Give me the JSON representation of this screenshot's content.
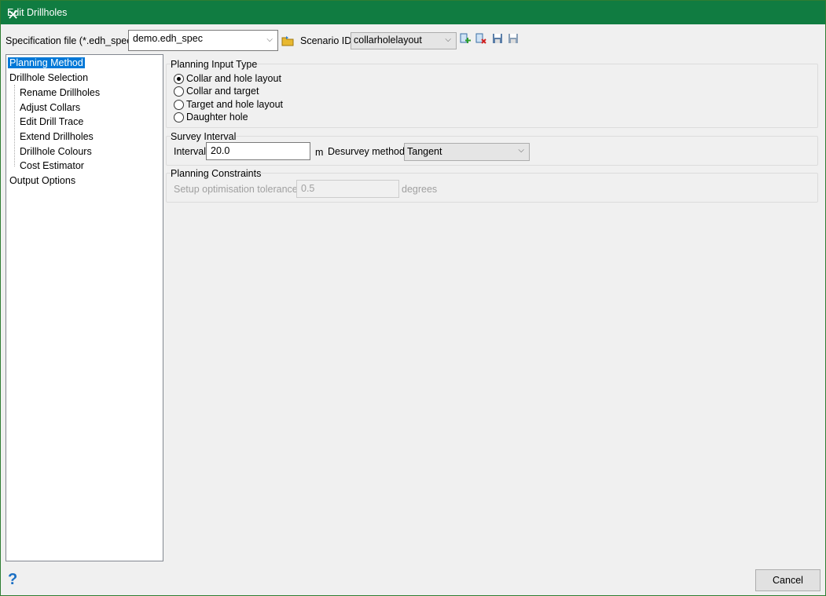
{
  "window": {
    "title": "Edit Drillholes"
  },
  "toolbar": {
    "spec_label": "Specification file (*.edh_spec)",
    "spec_value": "demo.edh_spec",
    "scenario_label": "Scenario ID",
    "scenario_value": "collarholelayout"
  },
  "tree": {
    "items": [
      {
        "label": "Planning Method"
      },
      {
        "label": "Drillhole Selection"
      },
      {
        "label": "Rename Drillholes"
      },
      {
        "label": "Adjust Collars"
      },
      {
        "label": "Edit Drill Trace"
      },
      {
        "label": "Extend Drillholes"
      },
      {
        "label": "Drillhole Colours"
      },
      {
        "label": "Cost Estimator"
      },
      {
        "label": "Output Options"
      }
    ]
  },
  "planning_input": {
    "title": "Planning Input Type",
    "options": [
      "Collar and hole layout",
      "Collar and target",
      "Target and hole layout",
      "Daughter hole"
    ],
    "selected": "Collar and hole layout"
  },
  "survey": {
    "title": "Survey Interval",
    "interval_label": "Interval",
    "interval_value": "20.0",
    "unit": "m",
    "desurvey_label": "Desurvey method",
    "desurvey_value": "Tangent"
  },
  "constraints": {
    "title": "Planning Constraints",
    "tolerance_label": "Setup optimisation tolerance",
    "tolerance_value": "0.5",
    "unit": "degrees"
  },
  "footer": {
    "cancel": "Cancel",
    "help": "?"
  }
}
